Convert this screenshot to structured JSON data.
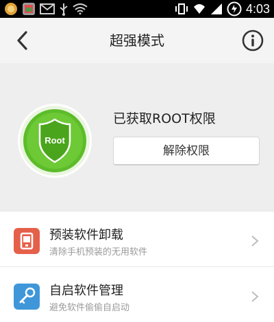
{
  "status_bar": {
    "time": "4:03",
    "left_icons": [
      "app-icon",
      "photo-icon",
      "mail-icon",
      "usb-icon",
      "wifi-icon"
    ],
    "right_icons": [
      "vibrate-icon",
      "wifi-icon",
      "signal-icon",
      "battery-icon"
    ]
  },
  "header": {
    "title": "超强模式",
    "back_icon": "chevron-left-icon",
    "info_icon": "info-icon"
  },
  "root_panel": {
    "badge_text": "Root",
    "status_text": "已获取ROOT权限",
    "button_label": "解除权限",
    "accent_color": "#5cbc2a"
  },
  "list": {
    "items": [
      {
        "title": "预装软件卸载",
        "subtitle": "清除手机预装的无用软件",
        "icon": "preinstalled-uninstall-icon",
        "icon_color": "#e5604a"
      },
      {
        "title": "自启软件管理",
        "subtitle": "避免软件偷偷自启动",
        "icon": "autostart-manager-icon",
        "icon_color": "#3f97d9"
      }
    ]
  }
}
